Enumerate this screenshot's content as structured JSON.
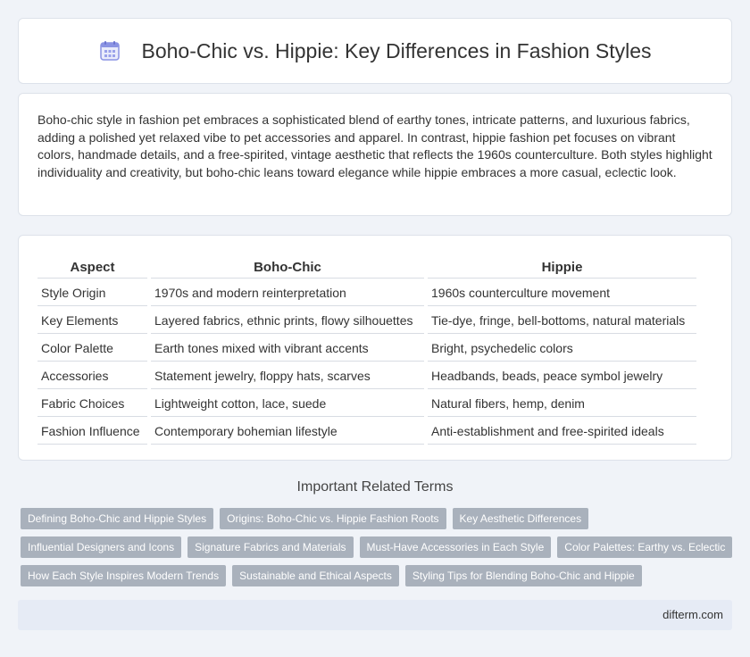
{
  "header": {
    "title": "Boho-Chic vs. Hippie: Key Differences in Fashion Styles",
    "icon": "calendar-icon"
  },
  "intro": {
    "text": "Boho-chic style in fashion pet embraces a sophisticated blend of earthy tones, intricate patterns, and luxurious fabrics, adding a polished yet relaxed vibe to pet accessories and apparel. In contrast, hippie fashion pet focuses on vibrant colors, handmade details, and a free-spirited, vintage aesthetic that reflects the 1960s counterculture. Both styles highlight individuality and creativity, but boho-chic leans toward elegance while hippie embraces a more casual, eclectic look."
  },
  "table": {
    "headers": [
      "Aspect",
      "Boho-Chic",
      "Hippie"
    ],
    "rows": [
      [
        "Style Origin",
        "1970s and modern reinterpretation",
        "1960s counterculture movement"
      ],
      [
        "Key Elements",
        "Layered fabrics, ethnic prints, flowy silhouettes",
        "Tie-dye, fringe, bell-bottoms, natural materials"
      ],
      [
        "Color Palette",
        "Earth tones mixed with vibrant accents",
        "Bright, psychedelic colors"
      ],
      [
        "Accessories",
        "Statement jewelry, floppy hats, scarves",
        "Headbands, beads, peace symbol jewelry"
      ],
      [
        "Fabric Choices",
        "Lightweight cotton, lace, suede",
        "Natural fibers, hemp, denim"
      ],
      [
        "Fashion Influence",
        "Contemporary bohemian lifestyle",
        "Anti-establishment and free-spirited ideals"
      ]
    ]
  },
  "related": {
    "title": "Important Related Terms",
    "tags": [
      [
        "Defining Boho-Chic and Hippie Styles",
        "Origins: Boho-Chic vs. Hippie Fashion Roots",
        "Key Aesthetic Differences"
      ],
      [
        "Influential Designers and Icons",
        "Signature Fabrics and Materials",
        "Must-Have Accessories in Each Style",
        "Color Palettes: Earthy vs. Eclectic"
      ],
      [
        "How Each Style Inspires Modern Trends",
        "Sustainable and Ethical Aspects",
        "Styling Tips for Blending Boho-Chic and Hippie"
      ]
    ]
  },
  "footer": {
    "site": "difterm.com"
  },
  "colors": {
    "background": "#f0f3f8",
    "tag_bg": "#a9b1bc",
    "footer_bg": "#e6ebf5",
    "icon_accent": "#7b86e0"
  }
}
